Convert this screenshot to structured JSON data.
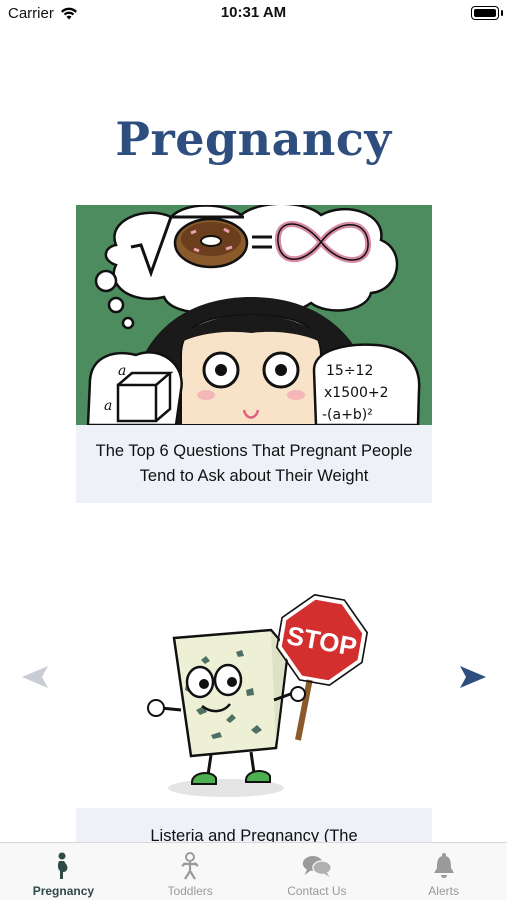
{
  "status_bar": {
    "carrier": "Carrier",
    "time": "10:31 AM"
  },
  "page": {
    "title": "Pregnancy"
  },
  "articles": [
    {
      "caption": "The Top 6 Questions That Pregnant People Tend to Ask about Their Weight",
      "image": "thinking-cartoon-illustration"
    },
    {
      "caption": "Listeria and Pregnancy (The",
      "image": "cheese-stop-sign-illustration",
      "sign_text": "STOP"
    }
  ],
  "carousel": {
    "prev_icon": "arrow-left-icon",
    "next_icon": "arrow-right-icon",
    "accent": "#2d4e7e"
  },
  "tabs": [
    {
      "label": "Pregnancy",
      "icon": "pregnant-woman-icon",
      "active": true
    },
    {
      "label": "Toddlers",
      "icon": "toddler-icon",
      "active": false
    },
    {
      "label": "Contact Us",
      "icon": "chat-bubbles-icon",
      "active": false
    },
    {
      "label": "Alerts",
      "icon": "bell-icon",
      "active": false
    }
  ],
  "colors": {
    "title": "#2d4e7e",
    "active_tab": "#2e4a46",
    "inactive_tab": "#9a9a9a",
    "caption_bg": "#eef1f8"
  }
}
